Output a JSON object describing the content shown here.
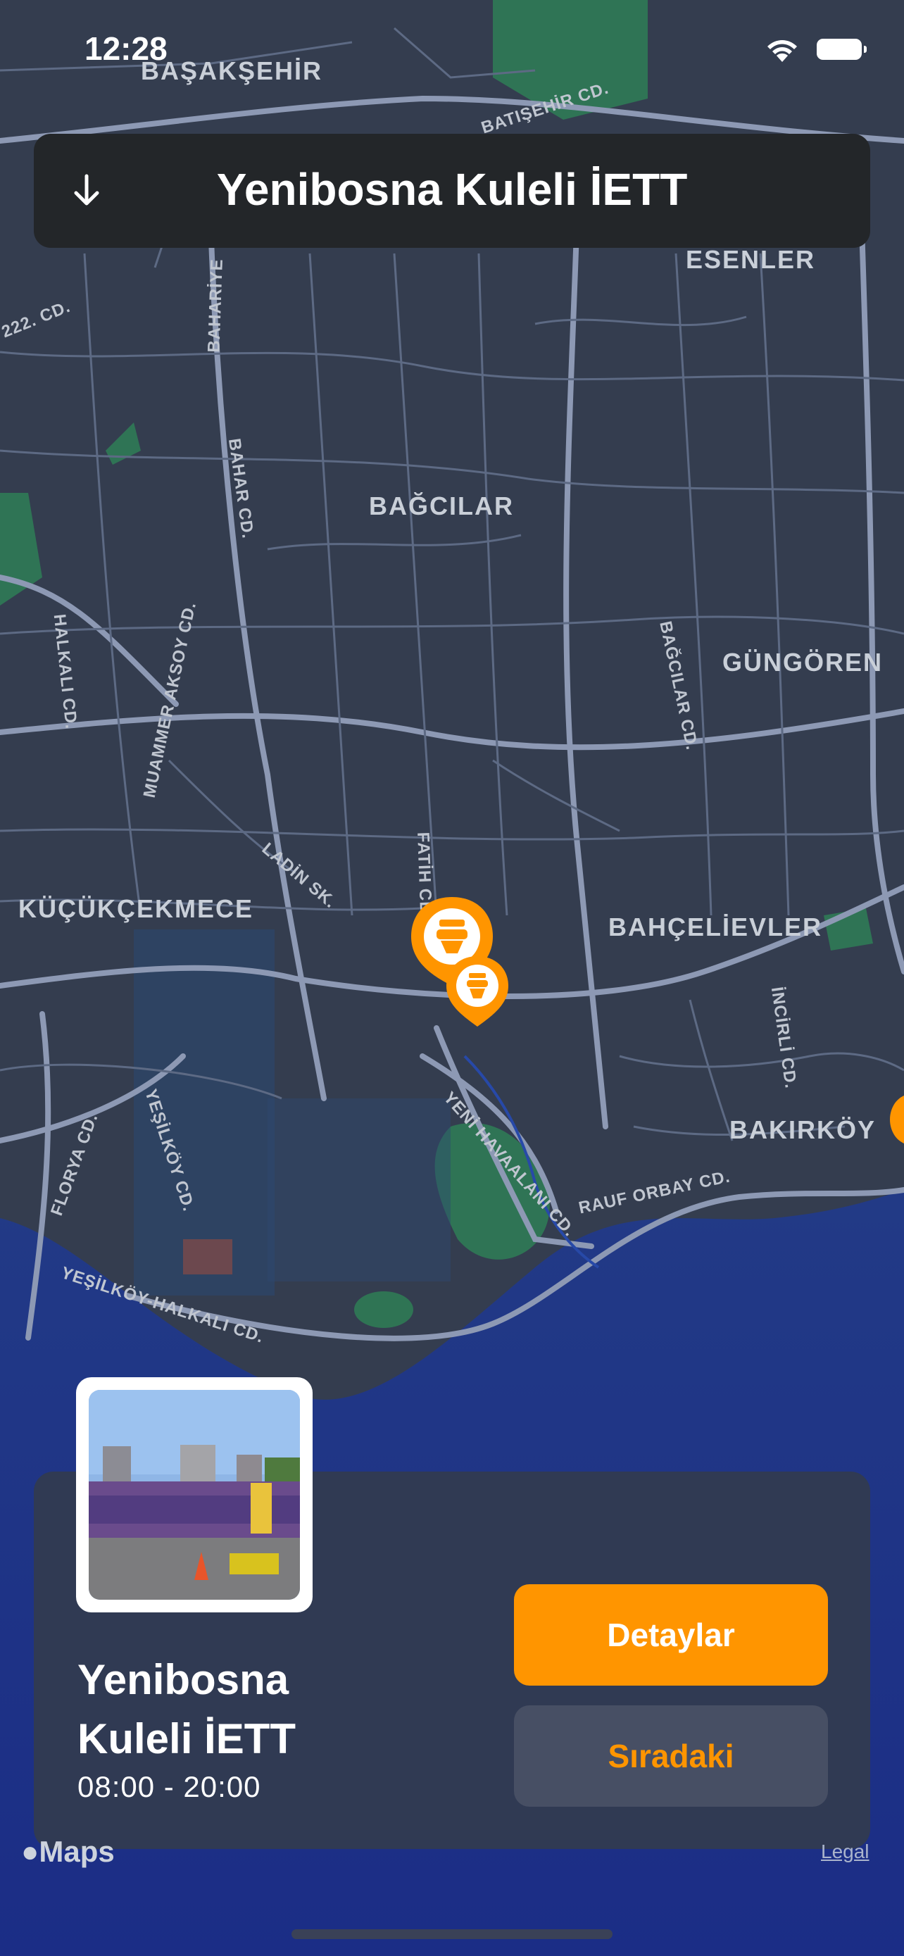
{
  "status_bar": {
    "time": "12:28"
  },
  "header": {
    "title": "Yenibosna Kuleli İETT"
  },
  "map": {
    "district_labels": [
      "BAŞAKŞEHİR",
      "ESENLER",
      "BAĞCILAR",
      "GÜNGÖREN",
      "KÜÇÜKÇEKMECE",
      "BAHÇELİEVLER",
      "BAKIRKÖY"
    ],
    "street_labels": [
      "BATIŞEHİR CD.",
      "BAHARİYE",
      "BAHAR CD.",
      "HALKALI CD.",
      "MUAMMER AKSOY CD.",
      "BAĞCILAR CD.",
      "LADİN SK.",
      "FATİH CD.",
      "İNCİRLİ CD.",
      "YENİ HAVAALANI CD.",
      "YEŞİLKÖY CD.",
      "FLORYA CD.",
      "RAUF ORBAY CD.",
      "YEŞİLKÖY-HALKALI CD.",
      "222. CD."
    ],
    "pin_icon": "toilet-icon"
  },
  "card": {
    "name": "Yenibosna Kuleli İETT",
    "hours": "08:00 - 20:00",
    "details_label": "Detaylar",
    "next_label": "Sıradaki"
  },
  "footer": {
    "maps_label": "Maps",
    "legal_label": "Legal"
  },
  "colors": {
    "accent": "#ff9500",
    "card": "#303a53",
    "header": "#232629",
    "map_bg": "#343d4f",
    "water": "#1f3d93"
  }
}
